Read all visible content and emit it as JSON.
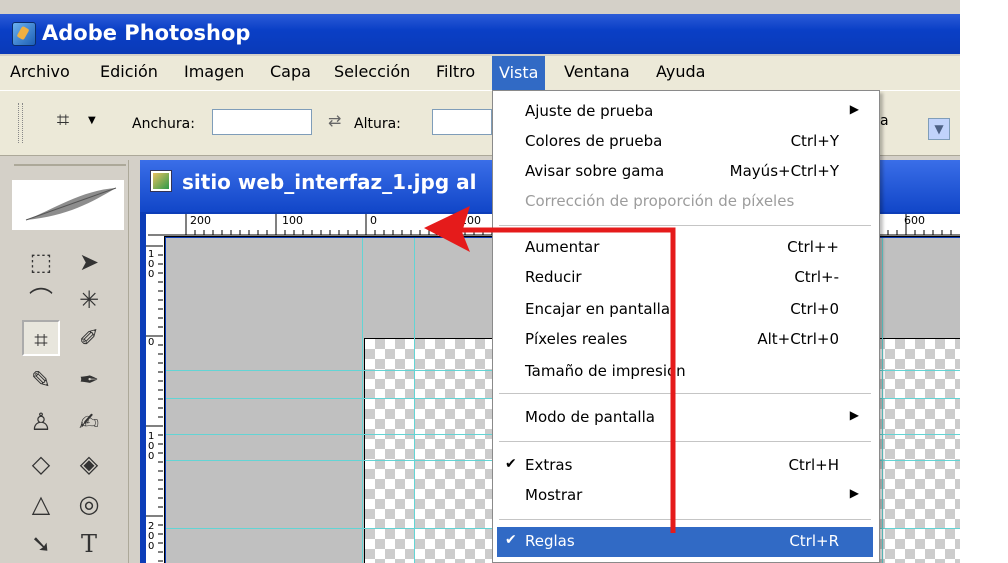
{
  "app": {
    "title": "Adobe Photoshop"
  },
  "menubar": {
    "items": [
      "Archivo",
      "Edición",
      "Imagen",
      "Capa",
      "Selección",
      "Filtro",
      "Vista",
      "Ventana",
      "Ayuda"
    ],
    "active": "Vista"
  },
  "options_bar": {
    "width_label": "Anchura:",
    "height_label": "Altura:",
    "width_value": "",
    "height_value": "",
    "trailing_text": "a"
  },
  "document": {
    "title": "sitio web_interfaz_1.jpg al",
    "hruler_ticks": [
      "200",
      "100",
      "0",
      "100",
      "600"
    ],
    "vruler_ticks": [
      "100",
      "0",
      "100",
      "200"
    ]
  },
  "view_menu": {
    "items": [
      {
        "label": "Ajuste de prueba",
        "shortcut": "",
        "submenu": true
      },
      {
        "label": "Colores de prueba",
        "shortcut": "Ctrl+Y"
      },
      {
        "label": "Avisar sobre gama",
        "shortcut": "Mayús+Ctrl+Y"
      },
      {
        "label": "Corrección de proporción de píxeles",
        "shortcut": "",
        "disabled": true
      },
      {
        "label": "Aumentar",
        "shortcut": "Ctrl++"
      },
      {
        "label": "Reducir",
        "shortcut": "Ctrl+-"
      },
      {
        "label": "Encajar en pantalla",
        "shortcut": "Ctrl+0"
      },
      {
        "label": "Píxeles reales",
        "shortcut": "Alt+Ctrl+0"
      },
      {
        "label": "Tamaño de impresión",
        "shortcut": ""
      },
      {
        "label": "Modo de pantalla",
        "shortcut": "",
        "submenu": true
      },
      {
        "label": "Extras",
        "shortcut": "Ctrl+H",
        "checked": true
      },
      {
        "label": "Mostrar",
        "shortcut": "",
        "submenu": true
      },
      {
        "label": "Reglas",
        "shortcut": "Ctrl+R",
        "checked": true,
        "selected": true
      }
    ]
  },
  "colors": {
    "selection": "#316ac5",
    "guide": "#63d4d4",
    "annotation_arrow": "#e51b1b"
  }
}
